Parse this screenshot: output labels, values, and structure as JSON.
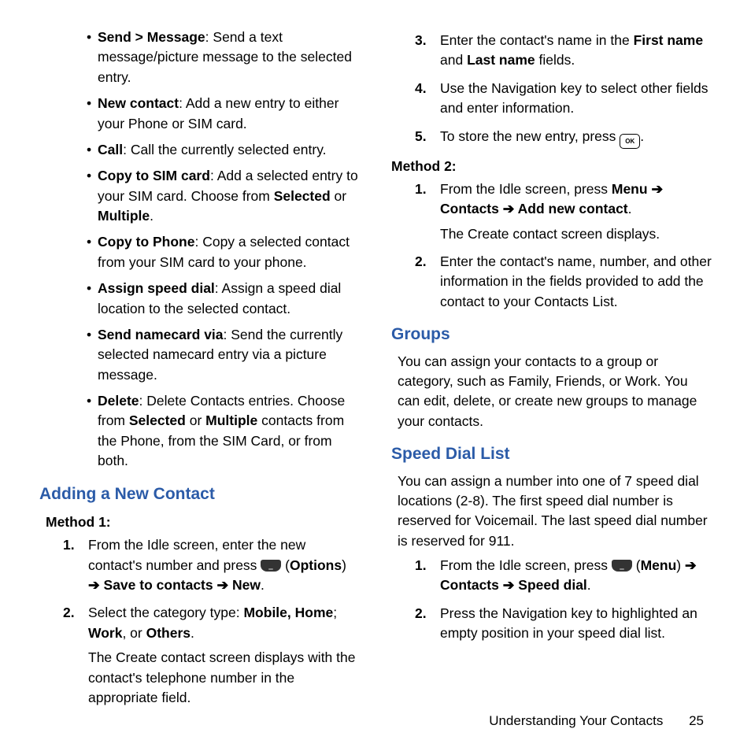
{
  "left": {
    "bullets": [
      {
        "term": "Send > Message",
        "desc": ": Send a text message/picture message to the selected entry."
      },
      {
        "term": "New contact",
        "desc": ": Add a new entry to either your Phone or SIM card."
      },
      {
        "term": "Call",
        "desc": ": Call the currently selected entry."
      },
      {
        "term": "Copy to SIM card",
        "desc_a": ": Add a selected entry to your SIM card. Choose from ",
        "b1": "Selected",
        "mid": " or ",
        "b2": "Multiple",
        "desc_b": "."
      },
      {
        "term": "Copy to Phone",
        "desc": ": Copy a selected contact from your SIM card to your phone."
      },
      {
        "term": "Assign speed dial",
        "desc": ": Assign a speed dial location to the selected contact."
      },
      {
        "term": "Send namecard via",
        "desc": ": Send the currently selected namecard entry via a picture message."
      },
      {
        "term": "Delete",
        "desc_a": ": Delete Contacts entries. Choose from ",
        "b1": "Selected",
        "mid": " or ",
        "b2": "Multiple",
        "desc_b": " contacts from the Phone, from the SIM Card, or from both."
      }
    ],
    "heading": "Adding a New Contact",
    "method1": "Method 1:",
    "step1": {
      "num": "1.",
      "a": "From the Idle screen, enter the new contact's number and press ",
      "paren_open": " (",
      "options": "Options",
      "paren_close": ") ",
      "arrow1": "➔ ",
      "save": "Save to contacts",
      "arrow2": " ➔ ",
      "new": "New",
      "end": "."
    },
    "step2": {
      "num": "2.",
      "a": "Select the category type: ",
      "b1": "Mobile, Home",
      "semi": "; ",
      "b2": "Work",
      "or": ", or ",
      "b3": "Others",
      "end": ".",
      "cont": "The Create contact screen displays with the contact's telephone number in the appropriate field."
    }
  },
  "right": {
    "step3": {
      "num": "3.",
      "a": "Enter the contact's name in the ",
      "b1": "First name",
      "mid": " and ",
      "b2": "Last name",
      "end": " fields."
    },
    "step4": {
      "num": "4.",
      "text": "Use the Navigation key to select other fields and enter information."
    },
    "step5": {
      "num": "5.",
      "a": "To store the new entry, press ",
      "end": "."
    },
    "method2": "Method 2:",
    "m2step1": {
      "num": "1.",
      "a": "From the Idle screen, press ",
      "b1": "Menu",
      "arrow1": " ➔ ",
      "b2": "Contacts",
      "arrow2": " ➔  ",
      "b3": "Add new contact",
      "end": ".",
      "cont": "The Create contact screen displays."
    },
    "m2step2": {
      "num": "2.",
      "text": "Enter the contact's name, number, and other information in the fields provided to add the contact to your Contacts List."
    },
    "groups_h": "Groups",
    "groups_p": "You can assign your contacts to a group or category, such as Family, Friends, or Work. You can edit, delete, or create new groups to manage your contacts.",
    "speed_h": "Speed Dial List",
    "speed_p": "You can assign a number into one of 7 speed dial locations (2-8). The first speed dial number is reserved for Voicemail. The last speed dial number is reserved for 911.",
    "sd_step1": {
      "num": "1.",
      "a": "From the Idle screen, press ",
      "paren_open": " (",
      "menu": "Menu",
      "paren_close": ") ",
      "arrow1": "➔ ",
      "b1": "Contacts",
      "arrow2": " ➔ ",
      "b2": "Speed dial",
      "end": "."
    },
    "sd_step2": {
      "num": "2.",
      "text": "Press the Navigation key to highlighted an empty position in your speed dial list."
    }
  },
  "footer": {
    "label": "Understanding Your Contacts",
    "page": "25"
  }
}
